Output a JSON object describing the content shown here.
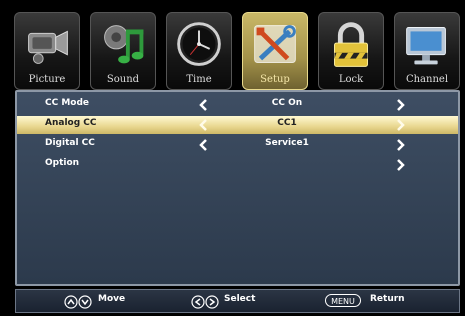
{
  "tabs": [
    {
      "label": "Picture",
      "icon": "camcorder-icon"
    },
    {
      "label": "Sound",
      "icon": "music-note-icon"
    },
    {
      "label": "Time",
      "icon": "clock-icon"
    },
    {
      "label": "Setup",
      "icon": "tools-icon",
      "active": true
    },
    {
      "label": "Lock",
      "icon": "padlock-icon"
    },
    {
      "label": "Channel",
      "icon": "monitor-icon"
    }
  ],
  "menu": {
    "rows": [
      {
        "name": "CC Mode",
        "value": "CC On"
      },
      {
        "name": "Analog CC",
        "value": "CC1",
        "selected": true
      },
      {
        "name": "Digital CC",
        "value": "Service1"
      },
      {
        "name": "Option",
        "value": ""
      }
    ]
  },
  "footer": {
    "move": "Move",
    "select": "Select",
    "menu_key": "MENU",
    "return": "Return"
  },
  "colors": {
    "panel": "#34455a",
    "highlight": "#e8d68e",
    "active_tab": "#b3a155"
  }
}
